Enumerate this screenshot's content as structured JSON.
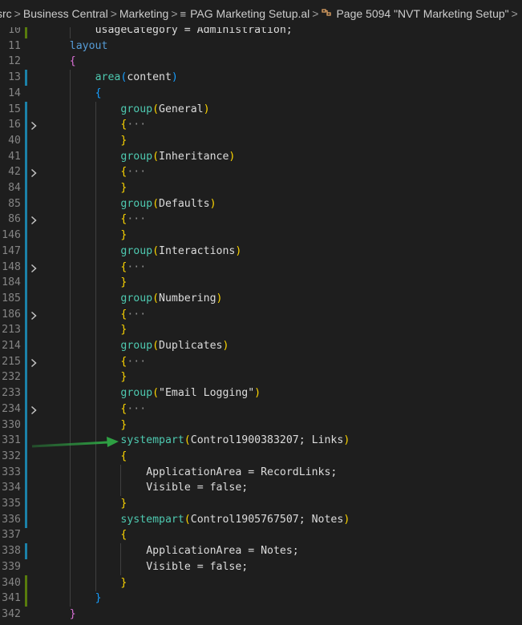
{
  "breadcrumb": {
    "items": [
      {
        "icon": "",
        "label": "src"
      },
      {
        "icon": "",
        "label": "Business Central"
      },
      {
        "icon": "",
        "label": "Marketing"
      },
      {
        "icon": "menu-lines-icon",
        "label": "PAG Marketing Setup.al"
      },
      {
        "icon": "symbol-class-icon",
        "label": "Page 5094 \"NVT Marketing Setup\""
      }
    ],
    "separator": ">"
  },
  "colors": {
    "background": "#1e1e1e",
    "line_number": "#858585",
    "keyword": "#569cd6",
    "method": "#4ec9b0",
    "bracket_level1": "#ffd700",
    "bracket_level2": "#da70d6",
    "bracket_level3": "#179fff",
    "string": "#ce9178",
    "modified_marker": "#1b81a8",
    "added_marker": "#587c0c",
    "annotation_arrow": "#2ea043"
  },
  "editor": {
    "lines": [
      {
        "num": "10",
        "indent": 2,
        "marker": "added",
        "fold": false,
        "tokens": [
          {
            "t": "usageCategory = Administration;",
            "c": "tk-id"
          }
        ]
      },
      {
        "num": "11",
        "indent": 1,
        "marker": "",
        "fold": false,
        "tokens": [
          {
            "t": "layout",
            "c": "tk-kw"
          }
        ]
      },
      {
        "num": "12",
        "indent": 1,
        "marker": "",
        "fold": false,
        "tokens": [
          {
            "t": "{",
            "c": "tk-p2"
          }
        ]
      },
      {
        "num": "13",
        "indent": 2,
        "marker": "modified",
        "fold": false,
        "tokens": [
          {
            "t": "area",
            "c": "tk-fn"
          },
          {
            "t": "(",
            "c": "tk-p3"
          },
          {
            "t": "content",
            "c": "tk-id"
          },
          {
            "t": ")",
            "c": "tk-p3"
          }
        ]
      },
      {
        "num": "14",
        "indent": 2,
        "marker": "",
        "fold": false,
        "tokens": [
          {
            "t": "{",
            "c": "tk-p3"
          }
        ]
      },
      {
        "num": "15",
        "indent": 3,
        "marker": "modified",
        "fold": false,
        "tokens": [
          {
            "t": "group",
            "c": "tk-fn"
          },
          {
            "t": "(",
            "c": "tk-p"
          },
          {
            "t": "General",
            "c": "tk-id"
          },
          {
            "t": ")",
            "c": "tk-p"
          }
        ]
      },
      {
        "num": "16",
        "indent": 3,
        "marker": "modified",
        "fold": true,
        "tokens": [
          {
            "t": "{",
            "c": "tk-p"
          },
          {
            "t": "···",
            "c": "tk-ell"
          }
        ]
      },
      {
        "num": "40",
        "indent": 3,
        "marker": "modified",
        "fold": false,
        "tokens": [
          {
            "t": "}",
            "c": "tk-p"
          }
        ]
      },
      {
        "num": "41",
        "indent": 3,
        "marker": "modified",
        "fold": false,
        "tokens": [
          {
            "t": "group",
            "c": "tk-fn"
          },
          {
            "t": "(",
            "c": "tk-p"
          },
          {
            "t": "Inheritance",
            "c": "tk-id"
          },
          {
            "t": ")",
            "c": "tk-p"
          }
        ]
      },
      {
        "num": "42",
        "indent": 3,
        "marker": "modified",
        "fold": true,
        "tokens": [
          {
            "t": "{",
            "c": "tk-p"
          },
          {
            "t": "···",
            "c": "tk-ell"
          }
        ]
      },
      {
        "num": "84",
        "indent": 3,
        "marker": "modified",
        "fold": false,
        "tokens": [
          {
            "t": "}",
            "c": "tk-p"
          }
        ]
      },
      {
        "num": "85",
        "indent": 3,
        "marker": "modified",
        "fold": false,
        "tokens": [
          {
            "t": "group",
            "c": "tk-fn"
          },
          {
            "t": "(",
            "c": "tk-p"
          },
          {
            "t": "Defaults",
            "c": "tk-id"
          },
          {
            "t": ")",
            "c": "tk-p"
          }
        ]
      },
      {
        "num": "86",
        "indent": 3,
        "marker": "modified",
        "fold": true,
        "tokens": [
          {
            "t": "{",
            "c": "tk-p"
          },
          {
            "t": "···",
            "c": "tk-ell"
          }
        ]
      },
      {
        "num": "146",
        "indent": 3,
        "marker": "modified",
        "fold": false,
        "tokens": [
          {
            "t": "}",
            "c": "tk-p"
          }
        ]
      },
      {
        "num": "147",
        "indent": 3,
        "marker": "modified",
        "fold": false,
        "tokens": [
          {
            "t": "group",
            "c": "tk-fn"
          },
          {
            "t": "(",
            "c": "tk-p"
          },
          {
            "t": "Interactions",
            "c": "tk-id"
          },
          {
            "t": ")",
            "c": "tk-p"
          }
        ]
      },
      {
        "num": "148",
        "indent": 3,
        "marker": "modified",
        "fold": true,
        "tokens": [
          {
            "t": "{",
            "c": "tk-p"
          },
          {
            "t": "···",
            "c": "tk-ell"
          }
        ]
      },
      {
        "num": "184",
        "indent": 3,
        "marker": "modified",
        "fold": false,
        "tokens": [
          {
            "t": "}",
            "c": "tk-p"
          }
        ]
      },
      {
        "num": "185",
        "indent": 3,
        "marker": "modified",
        "fold": false,
        "tokens": [
          {
            "t": "group",
            "c": "tk-fn"
          },
          {
            "t": "(",
            "c": "tk-p"
          },
          {
            "t": "Numbering",
            "c": "tk-id"
          },
          {
            "t": ")",
            "c": "tk-p"
          }
        ]
      },
      {
        "num": "186",
        "indent": 3,
        "marker": "modified",
        "fold": true,
        "tokens": [
          {
            "t": "{",
            "c": "tk-p"
          },
          {
            "t": "···",
            "c": "tk-ell"
          }
        ]
      },
      {
        "num": "213",
        "indent": 3,
        "marker": "modified",
        "fold": false,
        "tokens": [
          {
            "t": "}",
            "c": "tk-p"
          }
        ]
      },
      {
        "num": "214",
        "indent": 3,
        "marker": "modified",
        "fold": false,
        "tokens": [
          {
            "t": "group",
            "c": "tk-fn"
          },
          {
            "t": "(",
            "c": "tk-p"
          },
          {
            "t": "Duplicates",
            "c": "tk-id"
          },
          {
            "t": ")",
            "c": "tk-p"
          }
        ]
      },
      {
        "num": "215",
        "indent": 3,
        "marker": "modified",
        "fold": true,
        "tokens": [
          {
            "t": "{",
            "c": "tk-p"
          },
          {
            "t": "···",
            "c": "tk-ell"
          }
        ]
      },
      {
        "num": "232",
        "indent": 3,
        "marker": "modified",
        "fold": false,
        "tokens": [
          {
            "t": "}",
            "c": "tk-p"
          }
        ]
      },
      {
        "num": "233",
        "indent": 3,
        "marker": "modified",
        "fold": false,
        "tokens": [
          {
            "t": "group",
            "c": "tk-fn"
          },
          {
            "t": "(",
            "c": "tk-p"
          },
          {
            "t": "\"Email Logging\"",
            "c": "tk-id"
          },
          {
            "t": ")",
            "c": "tk-p"
          }
        ]
      },
      {
        "num": "234",
        "indent": 3,
        "marker": "modified",
        "fold": true,
        "tokens": [
          {
            "t": "{",
            "c": "tk-p"
          },
          {
            "t": "···",
            "c": "tk-ell"
          }
        ]
      },
      {
        "num": "330",
        "indent": 3,
        "marker": "modified",
        "fold": false,
        "tokens": [
          {
            "t": "}",
            "c": "tk-p"
          }
        ]
      },
      {
        "num": "331",
        "indent": 3,
        "marker": "modified",
        "fold": false,
        "tokens": [
          {
            "t": "systempart",
            "c": "tk-fn"
          },
          {
            "t": "(",
            "c": "tk-p"
          },
          {
            "t": "Control1900383207; Links",
            "c": "tk-id"
          },
          {
            "t": ")",
            "c": "tk-p"
          }
        ]
      },
      {
        "num": "332",
        "indent": 3,
        "marker": "modified",
        "fold": false,
        "tokens": [
          {
            "t": "{",
            "c": "tk-p"
          }
        ]
      },
      {
        "num": "333",
        "indent": 4,
        "marker": "modified",
        "fold": false,
        "tokens": [
          {
            "t": "ApplicationArea = RecordLinks;",
            "c": "tk-id"
          }
        ]
      },
      {
        "num": "334",
        "indent": 4,
        "marker": "modified",
        "fold": false,
        "tokens": [
          {
            "t": "Visible = false;",
            "c": "tk-id"
          }
        ]
      },
      {
        "num": "335",
        "indent": 3,
        "marker": "modified",
        "fold": false,
        "tokens": [
          {
            "t": "}",
            "c": "tk-p"
          }
        ]
      },
      {
        "num": "336",
        "indent": 3,
        "marker": "modified",
        "fold": false,
        "tokens": [
          {
            "t": "systempart",
            "c": "tk-fn"
          },
          {
            "t": "(",
            "c": "tk-p"
          },
          {
            "t": "Control1905767507; Notes",
            "c": "tk-id"
          },
          {
            "t": ")",
            "c": "tk-p"
          }
        ]
      },
      {
        "num": "337",
        "indent": 3,
        "marker": "",
        "fold": false,
        "tokens": [
          {
            "t": "{",
            "c": "tk-p"
          }
        ]
      },
      {
        "num": "338",
        "indent": 4,
        "marker": "modified",
        "fold": false,
        "tokens": [
          {
            "t": "ApplicationArea = Notes;",
            "c": "tk-id"
          }
        ]
      },
      {
        "num": "339",
        "indent": 4,
        "marker": "",
        "fold": false,
        "tokens": [
          {
            "t": "Visible = false;",
            "c": "tk-id"
          }
        ]
      },
      {
        "num": "340",
        "indent": 3,
        "marker": "added",
        "fold": false,
        "tokens": [
          {
            "t": "}",
            "c": "tk-p"
          }
        ]
      },
      {
        "num": "341",
        "indent": 2,
        "marker": "added",
        "fold": false,
        "tokens": [
          {
            "t": "}",
            "c": "tk-p3"
          }
        ]
      },
      {
        "num": "342",
        "indent": 1,
        "marker": "",
        "fold": false,
        "tokens": [
          {
            "t": "}",
            "c": "tk-p2"
          }
        ]
      }
    ]
  }
}
